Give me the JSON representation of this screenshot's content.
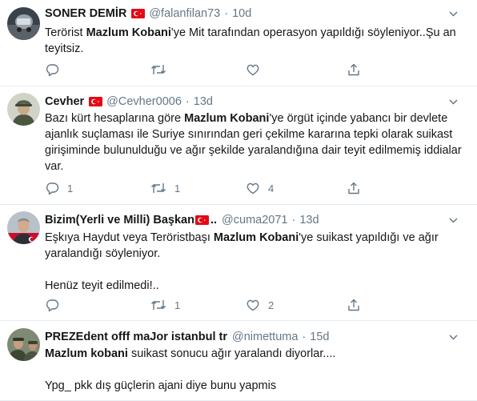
{
  "tweets": [
    {
      "name": "SONER DEMİR",
      "handle": "@falanfilan73",
      "time": "10d",
      "segments": [
        [
          {
            "t": "Terörist ",
            "b": false
          },
          {
            "t": "Mazlum Kobani",
            "b": true
          },
          {
            "t": "'ye  Mit tarafından operasyon yapıldığı söyleniyor..Şu an teyitsiz.",
            "b": false
          }
        ]
      ],
      "counts": {
        "reply": "",
        "retweet": "",
        "like": ""
      }
    },
    {
      "name": "Cevher",
      "handle": "@Cevher0006",
      "time": "13d",
      "segments": [
        [
          {
            "t": "Bazı kürt hesaplarına göre ",
            "b": false
          },
          {
            "t": "Mazlum Kobani",
            "b": true
          },
          {
            "t": "'ye örgüt içinde yabancı bir devlete ajanlık suçlaması ile Suriye sınırından geri çekilme kararına  tepki olarak suikast girişiminde bulunulduğu ve ağır şekilde yaralandığına dair teyit edilmemiş iddialar var.",
            "b": false
          }
        ]
      ],
      "counts": {
        "reply": "1",
        "retweet": "1",
        "like": "4"
      }
    },
    {
      "name": "Bizim(Yerli ve Milli) Başkan",
      "handle": "@cuma2071",
      "time": "13d",
      "segments": [
        [
          {
            "t": "Eşkıya Haydut veya Teröristbaşı ",
            "b": false
          },
          {
            "t": "Mazlum Kobani",
            "b": true
          },
          {
            "t": "'ye suikast yapıldığı ve ağır yaralandığı söyleniyor.",
            "b": false
          }
        ],
        [
          {
            "t": "Henüz teyit edilmedi!..",
            "b": false
          }
        ]
      ],
      "counts": {
        "reply": "",
        "retweet": "1",
        "like": "2"
      }
    },
    {
      "name": "PREZEdent offf maJor istanbul tr",
      "handle": "@nimettuma",
      "time": "15d",
      "segments": [
        [
          {
            "t": "Mazlum kobani",
            "b": true
          },
          {
            "t": " suikast sonucu ağır yaralandı diyorlar....",
            "b": false
          }
        ],
        [
          {
            "t": "Ypg_ pkk dış güçlerin ajani diye bunu yapmis",
            "b": false
          }
        ]
      ],
      "counts": {
        "reply": "",
        "retweet": "",
        "like": ""
      }
    }
  ],
  "ellipsis": "..",
  "colors": {
    "muted": "#657786",
    "text": "#14171a",
    "divider": "#e6ecf0",
    "flag": "#e30a17"
  },
  "icons": [
    "reply-icon",
    "retweet-icon",
    "like-icon",
    "share-icon",
    "caret-down-icon",
    "turkey-flag-icon"
  ]
}
